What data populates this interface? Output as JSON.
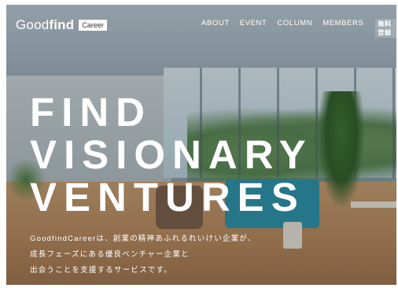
{
  "header": {
    "logo_main": "Good",
    "logo_bold": "find",
    "logo_badge": "Career",
    "nav": [
      "ABOUT",
      "EVENT",
      "COLUMN",
      "MEMBERS"
    ],
    "signup": "無料登録"
  },
  "hero": {
    "headline": [
      "FIND",
      "VISIONARY",
      "VENTURES"
    ],
    "lead": [
      "GoodfindCareerは、創業の精神あふれるれいけい企業が、",
      "成長フェーズにある優良ベンチャー企業と",
      "出会うことを支援するサービスです。"
    ]
  }
}
